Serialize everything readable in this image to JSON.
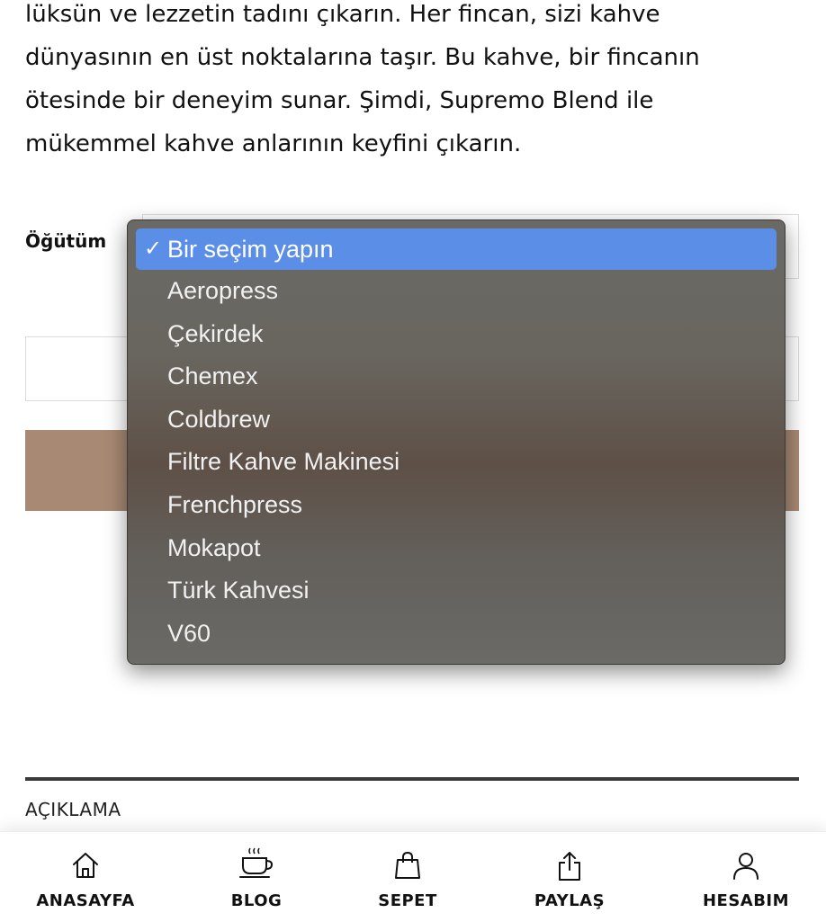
{
  "description": {
    "lines": [
      "lüksün ve lezzetin tadını çıkarın. Her fincan, sizi kahve",
      "dünyasının en üst noktalarına taşır. Bu kahve, bir fincanın",
      "ötesinde bir deneyim sunar. Şimdi, Supremo Blend ile",
      "mükemmel kahve anlarının keyfini çıkarın."
    ]
  },
  "variant": {
    "label": "Öğütüm",
    "dropdown": {
      "check_mark": "✓",
      "options": [
        "Bir seçim yapın",
        "Aeropress",
        "Çekirdek",
        "Chemex",
        "Coldbrew",
        "Filtre Kahve Makinesi",
        "Frenchpress",
        "Mokapot",
        "Türk Kahvesi",
        "V60"
      ],
      "selected_index": 0
    }
  },
  "tabs": {
    "description_heading": "AÇIKLAMA"
  },
  "bottom_nav": {
    "items": [
      {
        "label": "ANASAYFA",
        "icon": "home-icon"
      },
      {
        "label": "BLOG",
        "icon": "coffee-cup-icon"
      },
      {
        "label": "SEPET",
        "icon": "shopping-bag-icon"
      },
      {
        "label": "PAYLAŞ",
        "icon": "share-icon"
      },
      {
        "label": "HESABIM",
        "icon": "user-icon"
      }
    ]
  },
  "colors": {
    "add_to_cart_button": "#a88a74",
    "selected_option": "#5b8ee6",
    "divider": "#3a3a3a"
  }
}
